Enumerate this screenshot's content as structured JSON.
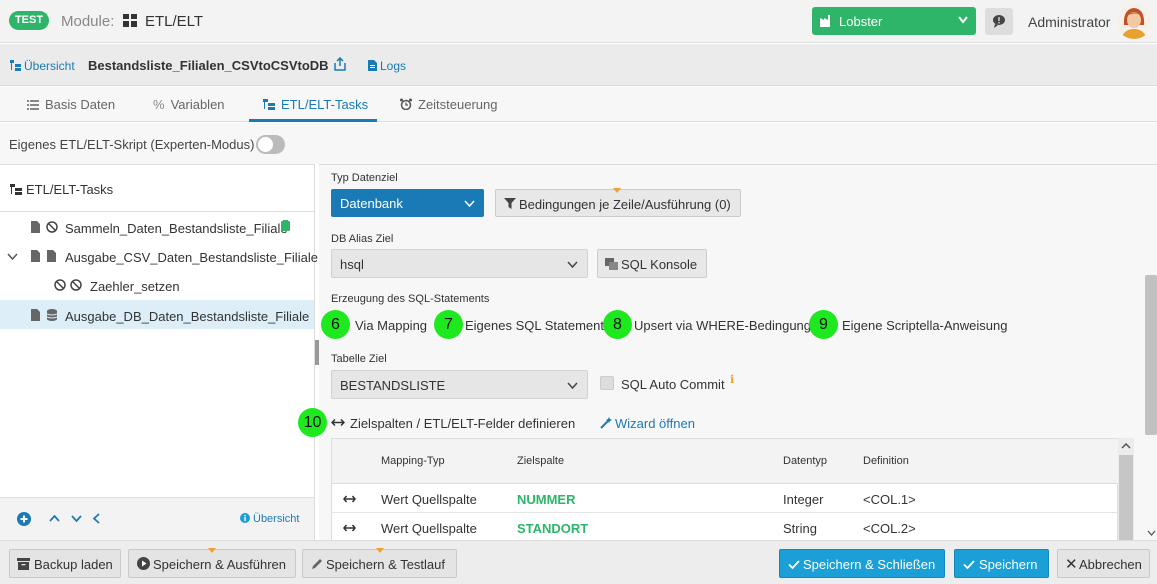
{
  "topbar": {
    "env_badge": "TEST",
    "module_label": "Module:",
    "module_name": "ETL/ELT",
    "org_select": "Lobster",
    "user_name": "Administrator"
  },
  "breadcrumb": {
    "overview_link": "Übersicht",
    "title": "Bestandsliste_Filialen_CSVtoCSVtoDB",
    "logs_link": "Logs"
  },
  "tabs": [
    {
      "label": "Basis Daten"
    },
    {
      "label": "Variablen"
    },
    {
      "label": "ETL/ELT-Tasks"
    },
    {
      "label": "Zeitsteuerung"
    }
  ],
  "expert_mode": {
    "label": "Eigenes ETL/ELT-Skript (Experten-Modus)",
    "enabled": false
  },
  "left_panel": {
    "heading": "ETL/ELT-Tasks",
    "tasks": [
      {
        "label": "Sammeln_Daten_Bestandsliste_Filiale",
        "selected": false
      },
      {
        "label": "Ausgabe_CSV_Daten_Bestandsliste_Filiale",
        "selected": false
      },
      {
        "label": "Zaehler_setzen",
        "selected": false
      },
      {
        "label": "Ausgabe_DB_Daten_Bestandsliste_Filiale",
        "selected": true
      }
    ],
    "footer_overview": "Übersicht"
  },
  "form": {
    "target_type_label": "Typ Datenziel",
    "target_type_value": "Datenbank",
    "conditions_button": "Bedingungen je Zeile/Ausführung (0)",
    "db_alias_label": "DB Alias Ziel",
    "db_alias_value": "hsql",
    "sql_console_button": "SQL Konsole",
    "sql_gen_label": "Erzeugung des SQL-Statements",
    "sql_gen_options": [
      {
        "num": "6",
        "label": "Via Mapping"
      },
      {
        "num": "7",
        "label": "Eigenes SQL Statement"
      },
      {
        "num": "8",
        "label": "Upsert via WHERE-Bedingung"
      },
      {
        "num": "9",
        "label": "Eigene Scriptella-Anweisung"
      }
    ],
    "table_label": "Tabelle Ziel",
    "table_value": "BESTANDSLISTE",
    "auto_commit_label": "SQL Auto Commit",
    "auto_commit_checked": false,
    "columns_marker": "10",
    "columns_heading": "Zielspalten / ETL/ELT-Felder definieren",
    "wizard_link": "Wizard öffnen"
  },
  "mapping_table": {
    "headers": [
      "Mapping-Typ",
      "Zielspalte",
      "Datentyp",
      "Definition"
    ],
    "rows": [
      {
        "type": "Wert Quellspalte",
        "column": "NUMMER",
        "datatype": "Integer",
        "definition": "<COL.1>"
      },
      {
        "type": "Wert Quellspalte",
        "column": "STANDORT",
        "datatype": "String",
        "definition": "<COL.2>"
      }
    ]
  },
  "bottom_buttons": {
    "load_backup": "Backup laden",
    "save_run": "Speichern & Ausführen",
    "save_test": "Speichern & Testlauf",
    "save_close": "Speichern & Schließen",
    "save": "Speichern",
    "cancel": "Abbrechen"
  },
  "colors": {
    "accent": "#1a7ab5",
    "success": "#2fb56a",
    "marker_green": "#1ee81e",
    "primary_button": "#1a9fd6"
  }
}
